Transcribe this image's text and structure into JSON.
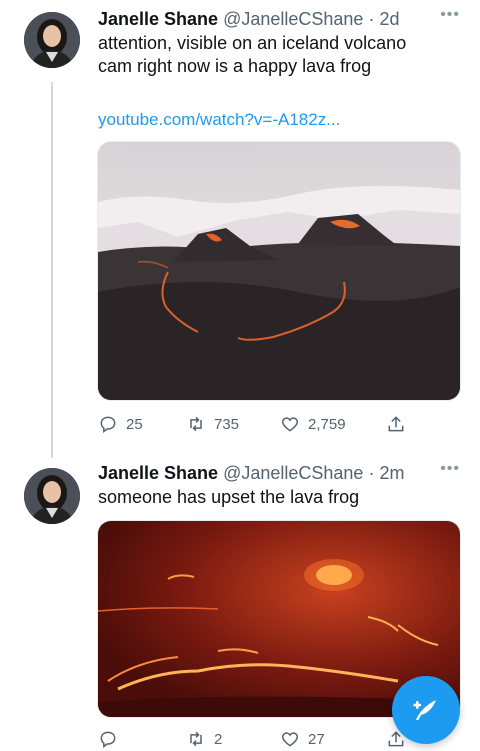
{
  "tweets": [
    {
      "name": "Janelle Shane",
      "handle": "@JanelleCShane",
      "separator": "·",
      "time": "2d",
      "text_lines": [
        "attention, visible on an iceland volcano",
        "cam right now is a happy lava frog"
      ],
      "link": "youtube.com/watch?v=-A182z...",
      "media_icon": "volcano-landscape-photo",
      "replies": "",
      "retweets": "735",
      "likes": "2,759",
      "reply_count": "25"
    },
    {
      "name": "Janelle Shane",
      "handle": "@JanelleCShane",
      "separator": "·",
      "time": "2m",
      "text_lines": [
        "someone has upset the lava frog"
      ],
      "media_icon": "lava-night-photo",
      "reply_count": "",
      "retweets": "2",
      "likes": "27"
    }
  ],
  "icons": {
    "more": "more-icon",
    "reply": "reply-icon",
    "retweet": "retweet-icon",
    "like": "heart-icon",
    "share": "share-icon",
    "compose": "compose-icon"
  },
  "colors": {
    "accent": "#1d9bf0",
    "text": "#0f1419",
    "muted": "#536471"
  }
}
